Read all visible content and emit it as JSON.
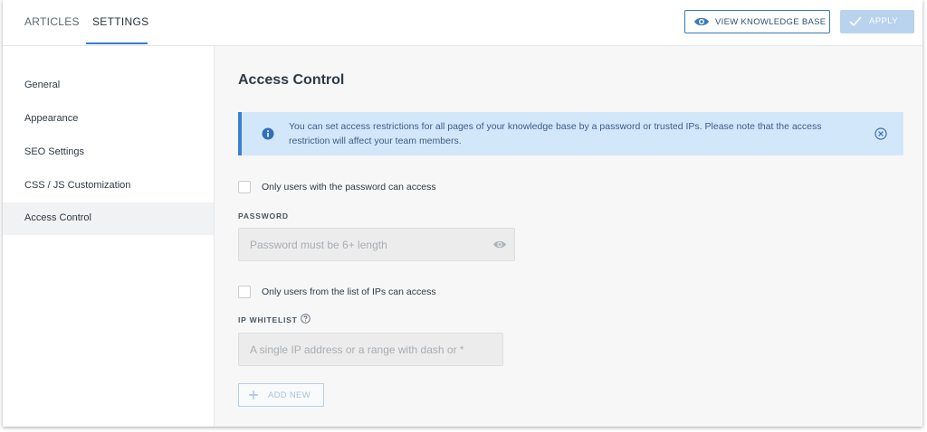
{
  "header": {
    "tabs": [
      {
        "label": "ARTICLES",
        "active": false
      },
      {
        "label": "SETTINGS",
        "active": true
      }
    ],
    "view_kb_label": "VIEW KNOWLEDGE BASE",
    "apply_label": "APPLY"
  },
  "sidebar": {
    "items": [
      {
        "label": "General",
        "active": false
      },
      {
        "label": "Appearance",
        "active": false
      },
      {
        "label": "SEO Settings",
        "active": false
      },
      {
        "label": "CSS / JS Customization",
        "active": false
      },
      {
        "label": "Access Control",
        "active": true
      }
    ]
  },
  "main": {
    "title": "Access Control",
    "alert": {
      "message": "You can set access restrictions for all pages of your knowledge base by a password or trusted IPs. Please note that the access restriction will affect your team members.",
      "icon": "info-icon"
    },
    "password_option": {
      "label": "Only users with the password can access",
      "checked": false
    },
    "password_field": {
      "label": "PASSWORD",
      "placeholder": "Password must be 6+ length",
      "value": ""
    },
    "ip_option": {
      "label": "Only users from the list of IPs can access",
      "checked": false
    },
    "ip_field": {
      "label": "IP WHITELIST",
      "placeholder": "A single IP address or a range with dash or *",
      "value": ""
    },
    "add_new_label": "ADD NEW"
  },
  "colors": {
    "accent": "#3a7bd5",
    "alert_bg": "#d3e7fb",
    "apply_disabled": "#b9d2ee"
  }
}
